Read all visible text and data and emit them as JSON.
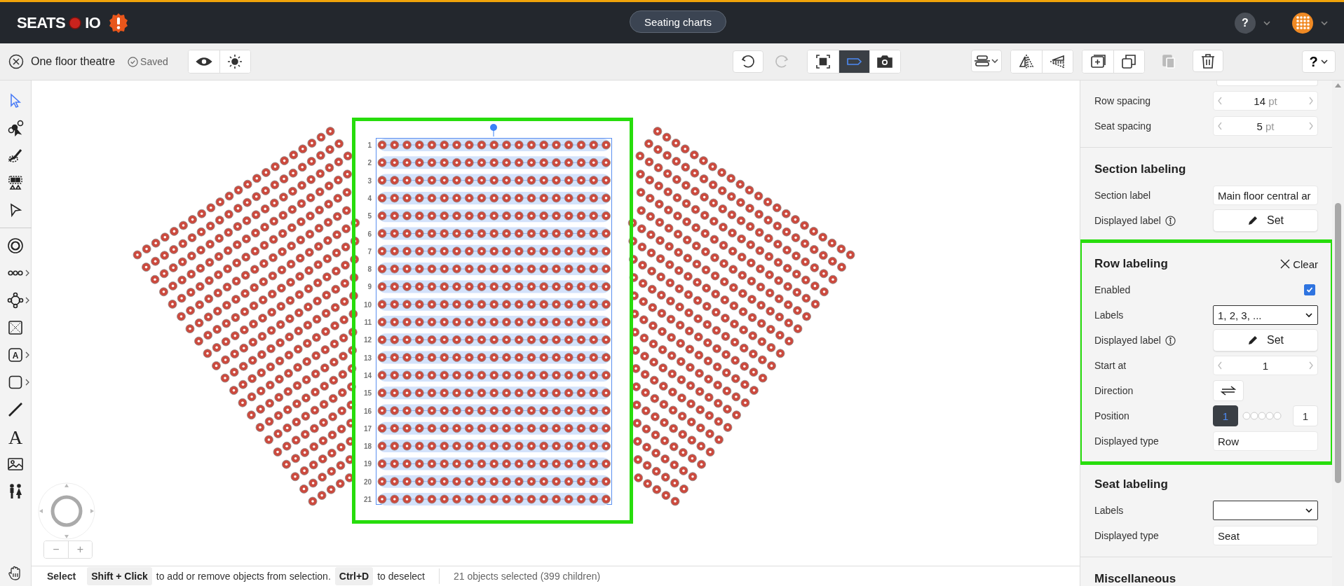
{
  "header": {
    "logo_left": "SEATS",
    "logo_right": "IO",
    "center_button": "Seating charts",
    "help": "?"
  },
  "toolbar": {
    "chart_name": "One floor theatre",
    "save_status": "Saved",
    "view_buttons": [
      {
        "kind": "preview",
        "selected": false
      },
      {
        "kind": "theme",
        "selected": false
      }
    ],
    "history": [
      {
        "kind": "undo",
        "disabled": false
      },
      {
        "kind": "redo",
        "disabled": true
      }
    ],
    "canvas_tools": [
      {
        "kind": "focus",
        "selected": false
      },
      {
        "kind": "label",
        "selected": true
      },
      {
        "kind": "snapshot",
        "selected": false
      }
    ],
    "edit_groups": [
      {
        "tools": [
          {
            "kind": "align",
            "disabled": false
          }
        ]
      },
      {
        "tools": [
          {
            "kind": "flip",
            "disabled": false
          },
          {
            "kind": "perspective",
            "disabled": false
          }
        ]
      },
      {
        "tools": [
          {
            "kind": "duplicate",
            "disabled": false
          },
          {
            "kind": "copy",
            "disabled": false
          }
        ]
      },
      {
        "tools": [
          {
            "kind": "paste",
            "disabled": true
          }
        ]
      },
      {
        "tools": [
          {
            "kind": "delete",
            "disabled": false
          }
        ]
      }
    ],
    "help_menu": "?"
  },
  "tools_top": [
    {
      "kind": "pointer",
      "selected": true,
      "has_menu": false
    },
    {
      "kind": "node-select",
      "selected": false,
      "has_menu": false
    },
    {
      "kind": "brush",
      "selected": false,
      "has_menu": false
    },
    {
      "kind": "seat-select",
      "selected": false,
      "has_menu": false
    },
    {
      "kind": "arrow-outline",
      "selected": false,
      "has_menu": false
    }
  ],
  "tools_bottom": [
    {
      "kind": "circle",
      "selected": false,
      "has_menu": false
    },
    {
      "kind": "row",
      "selected": false,
      "has_menu": true
    },
    {
      "kind": "table",
      "selected": false,
      "has_menu": true
    },
    {
      "kind": "booth",
      "selected": false,
      "has_menu": false
    },
    {
      "kind": "text-label",
      "glyph": "A",
      "selected": false,
      "has_menu": true
    },
    {
      "kind": "shape",
      "selected": false,
      "has_menu": true
    },
    {
      "kind": "line",
      "selected": false,
      "has_menu": false
    },
    {
      "kind": "text",
      "glyph": "A",
      "selected": false,
      "has_menu": false
    },
    {
      "kind": "image",
      "selected": false,
      "has_menu": false
    },
    {
      "kind": "restroom",
      "selected": false,
      "has_menu": false
    }
  ],
  "canvas": {
    "row_labels": [
      "1",
      "2",
      "3",
      "4",
      "5",
      "6",
      "7",
      "8",
      "9",
      "10",
      "11",
      "12",
      "13",
      "14",
      "15",
      "16",
      "17",
      "18",
      "19",
      "20",
      "21"
    ],
    "zoom_controls": [
      "−",
      "+"
    ]
  },
  "panel": {
    "sections": [
      {
        "highlighted": false,
        "rows": [
          {
            "kind": "stepper",
            "label": "Row spacing",
            "value": "14",
            "unit": "pt"
          },
          {
            "kind": "stepper",
            "label": "Seat spacing",
            "value": "5",
            "unit": "pt"
          }
        ]
      },
      {
        "title": "Section labeling",
        "highlighted": false,
        "rows": [
          {
            "kind": "text",
            "label": "Section label",
            "value": "Main floor central ar"
          },
          {
            "kind": "set",
            "label": "Displayed label",
            "button": "Set"
          }
        ]
      },
      {
        "title": "Row labeling",
        "action": "Clear",
        "highlighted": true,
        "rows": [
          {
            "kind": "checkbox",
            "label": "Enabled",
            "checked": true
          },
          {
            "kind": "select",
            "label": "Labels",
            "value": "1, 2, 3, ..."
          },
          {
            "kind": "set",
            "label": "Displayed label",
            "button": "Set"
          },
          {
            "kind": "stepper",
            "label": "Start at",
            "value": "1"
          },
          {
            "kind": "direction",
            "label": "Direction"
          },
          {
            "kind": "position",
            "label": "Position",
            "marker": "1",
            "selected": true,
            "count": "1"
          },
          {
            "kind": "text",
            "label": "Displayed type",
            "value": "Row"
          }
        ]
      },
      {
        "title": "Seat labeling",
        "highlighted": false,
        "rows": [
          {
            "kind": "select",
            "label": "Labels"
          },
          {
            "kind": "text",
            "label": "Displayed type",
            "value": "Seat"
          }
        ]
      },
      {
        "title": "Miscellaneous",
        "highlighted": false
      }
    ]
  },
  "status_bar": {
    "mode": "Select",
    "hints": [
      {
        "key": "Shift + Click",
        "text": "to add or remove objects from selection."
      },
      {
        "key": "Ctrl+D",
        "text": "to deselect"
      }
    ],
    "selection": "21 objects selected (399 children)"
  }
}
